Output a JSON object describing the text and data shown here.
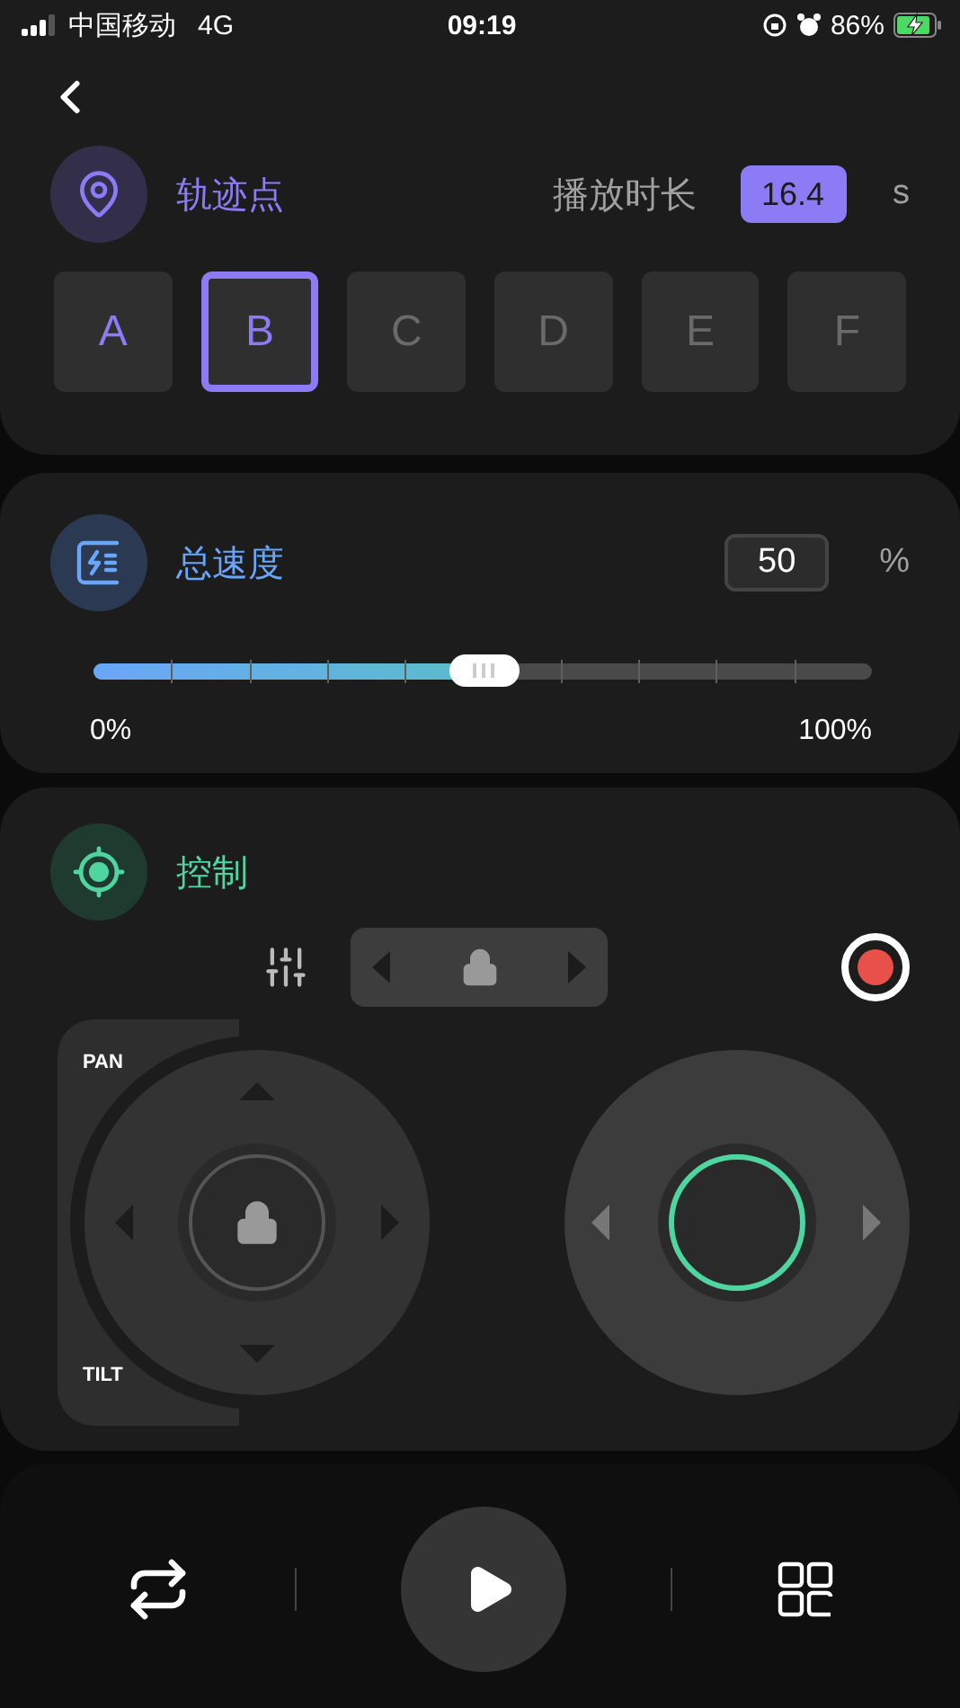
{
  "status_bar": {
    "carrier": "中国移动",
    "network": "4G",
    "time": "09:19",
    "battery": "86%",
    "charging": true
  },
  "trajectory": {
    "title": "轨迹点",
    "duration_label": "播放时长",
    "duration": "16.4",
    "unit": "s",
    "points": [
      {
        "label": "A",
        "selected": false,
        "set": true
      },
      {
        "label": "B",
        "selected": true,
        "set": true
      },
      {
        "label": "C",
        "selected": false,
        "set": false
      },
      {
        "label": "D",
        "selected": false,
        "set": false
      },
      {
        "label": "E",
        "selected": false,
        "set": false
      },
      {
        "label": "F",
        "selected": false,
        "set": false
      }
    ]
  },
  "speed": {
    "title": "总速度",
    "value": "50",
    "unit": "%",
    "level": 0.5,
    "min_label": "0%",
    "max_label": "100%"
  },
  "control": {
    "title": "控制",
    "pan_label": "PAN",
    "tilt_label": "TILT",
    "recording": true
  }
}
